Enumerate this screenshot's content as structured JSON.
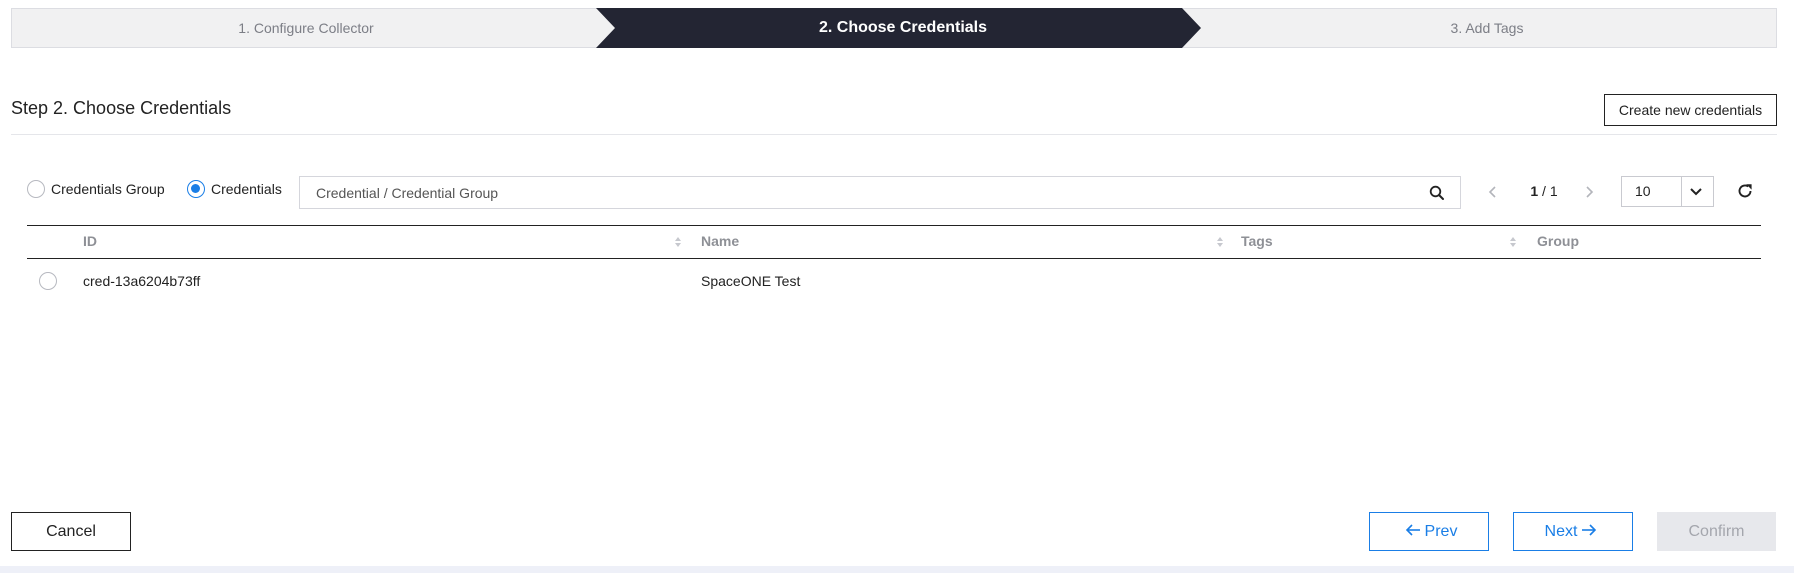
{
  "wizard": {
    "steps": [
      {
        "label": "1. Configure Collector",
        "active": false
      },
      {
        "label": "2. Choose Credentials",
        "active": true
      },
      {
        "label": "3. Add Tags",
        "active": false
      }
    ]
  },
  "header": {
    "title": "Step 2. Choose Credentials",
    "create_button": "Create new credentials"
  },
  "filters": {
    "options": [
      {
        "label": "Credentials Group",
        "selected": false
      },
      {
        "label": "Credentials",
        "selected": true
      }
    ],
    "search": {
      "placeholder": "Credential / Credential Group",
      "value": ""
    }
  },
  "pagination": {
    "current": "1",
    "total": "1",
    "page_size": "10"
  },
  "table": {
    "columns": [
      "ID",
      "Name",
      "Tags",
      "Group"
    ],
    "rows": [
      {
        "id": "cred-13a6204b73ff",
        "name": "SpaceONE Test",
        "tags": "",
        "group": ""
      }
    ]
  },
  "footer": {
    "cancel": "Cancel",
    "prev": "Prev",
    "next": "Next",
    "confirm": "Confirm"
  },
  "colors": {
    "active_step": "#232533",
    "accent": "#1a7ee6",
    "disabled": "#e7e8ec"
  }
}
